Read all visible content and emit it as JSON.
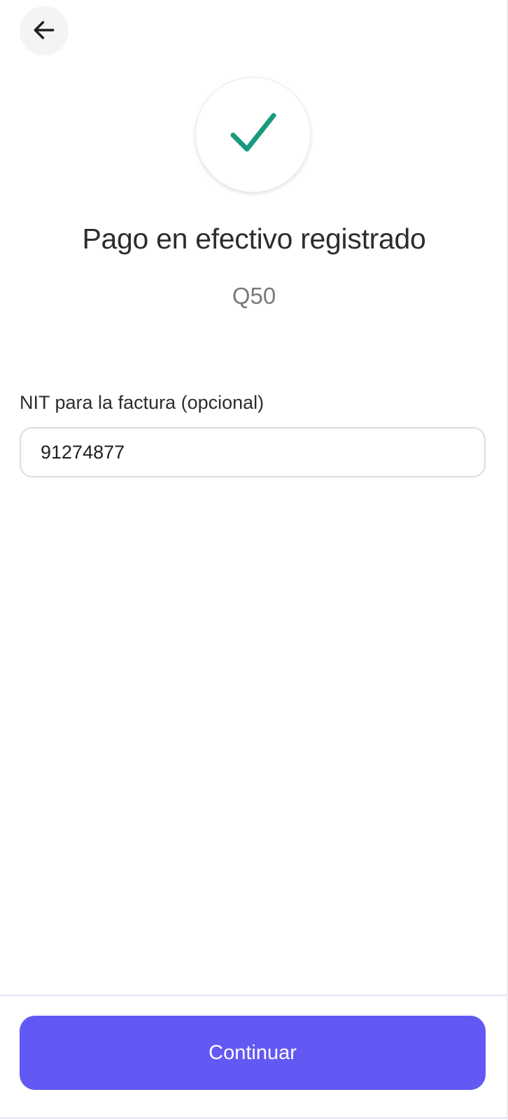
{
  "header": {
    "back_icon": "arrow-left-icon"
  },
  "status": {
    "icon": "checkmark-icon",
    "accent_color": "#199A7E",
    "title": "Pago en efectivo registrado",
    "amount": "Q50"
  },
  "form": {
    "nit_label": "NIT para la factura (opcional)",
    "nit_value": "91274877"
  },
  "footer": {
    "continue_label": "Continuar",
    "button_color": "#6259F4"
  }
}
